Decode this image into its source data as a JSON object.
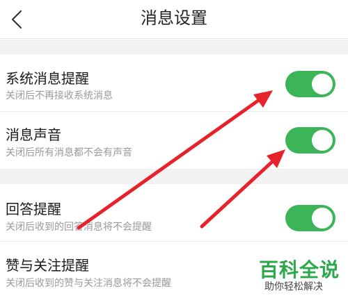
{
  "header": {
    "title": "消息设置"
  },
  "settings": [
    {
      "title": "系统消息提醒",
      "subtitle": "关闭后不再接收系统消息",
      "enabled": true
    },
    {
      "title": "消息声音",
      "subtitle": "关闭后所有消息都不会有声音",
      "enabled": true
    },
    {
      "title": "回答提醒",
      "subtitle": "关闭后收到的回答消息将不会提醒",
      "enabled": true
    },
    {
      "title": "赞与关注提醒",
      "subtitle": "关闭后收到的赞与关注消息将不会提醒",
      "enabled": true
    }
  ],
  "watermark": {
    "main": "百科全说",
    "sub": "助你轻松解决"
  },
  "colors": {
    "toggle_on": "#3cb558",
    "arrow": "#e8222b",
    "watermark": "#2aa84a"
  }
}
